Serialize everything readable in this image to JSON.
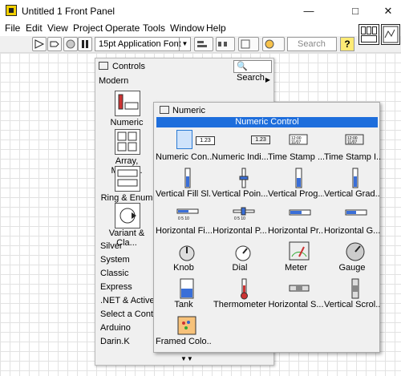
{
  "window": {
    "title": "Untitled 1 Front Panel"
  },
  "menu": [
    "File",
    "Edit",
    "View",
    "Project",
    "Operate",
    "Tools",
    "Window",
    "Help"
  ],
  "toolbar": {
    "font": "15pt Application Font",
    "search_placeholder": "Search",
    "help_label": "?"
  },
  "controls_palette": {
    "title": "Controls",
    "search_label": "Search",
    "category": "Modern",
    "grid": [
      "Numeric",
      "Array, Matrix...",
      "Ring & Enum",
      "Variant & Cla..."
    ],
    "sublists": [
      "Silver",
      "System",
      "Classic",
      "Express",
      ".NET & ActiveX",
      "Select a Control...",
      "Arduino",
      "Darin.K"
    ]
  },
  "numeric_palette": {
    "title": "Numeric",
    "header": "Numeric Control",
    "items": [
      "Numeric Con...",
      "Numeric Indi...",
      "Time Stamp ...",
      "Time Stamp I...",
      "Vertical Fill Sl...",
      "Vertical Poin...",
      "Vertical Prog...",
      "Vertical Grad...",
      "Horizontal Fi...",
      "Horizontal P...",
      "Horizontal Pr...",
      "Horizontal G...",
      "Knob",
      "Dial",
      "Meter",
      "Gauge",
      "Tank",
      "Thermometer",
      "Horizontal S...",
      "Vertical Scrol...",
      "Framed Colo..."
    ]
  },
  "colors": {
    "selection": "#1e6edc",
    "palette_bg": "#f0f0f0"
  }
}
